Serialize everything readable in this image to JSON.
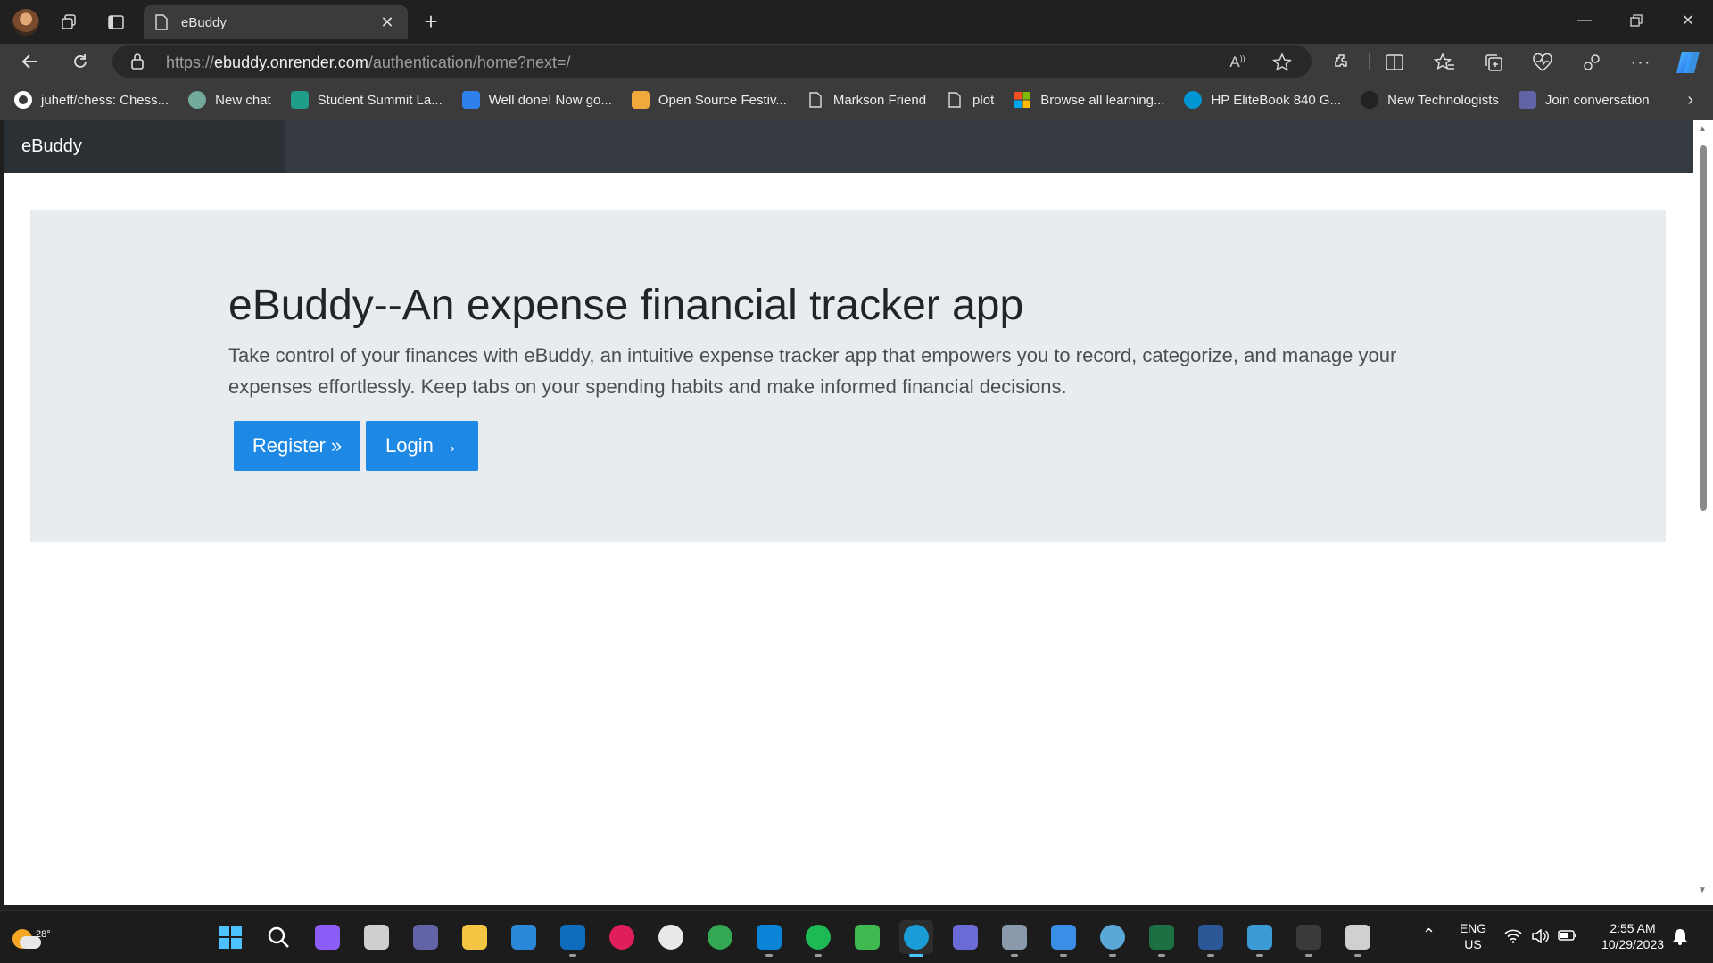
{
  "browser": {
    "tab": {
      "title": "eBuddy"
    },
    "url": {
      "scheme": "https://",
      "host": "ebuddy.onrender.com",
      "path": "/authentication/home?next=/"
    },
    "bookmarks": [
      {
        "label": "juheff/chess: Chess...",
        "icon": "github-icon",
        "color": "#ffffff"
      },
      {
        "label": "New chat",
        "icon": "chatgpt-icon",
        "color": "#74aa9c"
      },
      {
        "label": "Student Summit La...",
        "icon": "summit-icon",
        "color": "#1e9e8a"
      },
      {
        "label": "Well done! Now go...",
        "icon": "iq-icon",
        "color": "#2f80ed"
      },
      {
        "label": "Open Source Festiv...",
        "icon": "osf-icon",
        "color": "#f2a93b"
      },
      {
        "label": "Markson Friend",
        "icon": "page-icon",
        "color": "#dddddd"
      },
      {
        "label": "plot",
        "icon": "page-icon",
        "color": "#dddddd"
      },
      {
        "label": "Browse all learning...",
        "icon": "microsoft-icon",
        "color": "#f25022"
      },
      {
        "label": "HP EliteBook 840 G...",
        "icon": "hp-icon",
        "color": "#0096d6"
      },
      {
        "label": "New Technologists",
        "icon": "newtech-icon",
        "color": "#222222"
      },
      {
        "label": "Join conversation",
        "icon": "teams-icon",
        "color": "#6264a7"
      }
    ]
  },
  "page": {
    "brand": "eBuddy",
    "hero": {
      "title": "eBuddy--An expense financial tracker app",
      "text": "Take control of your finances with eBuddy, an intuitive expense tracker app that empowers you to record, categorize, and manage your expenses effortlessly. Keep tabs on your spending habits and make informed financial decisions.",
      "register_label": "Register »",
      "login_label": "Login →"
    }
  },
  "taskbar": {
    "weather_temp": "28°",
    "language": "ENG",
    "region": "US",
    "time": "2:55 AM",
    "date": "10/29/2023",
    "accent": "#4cc2ff"
  }
}
